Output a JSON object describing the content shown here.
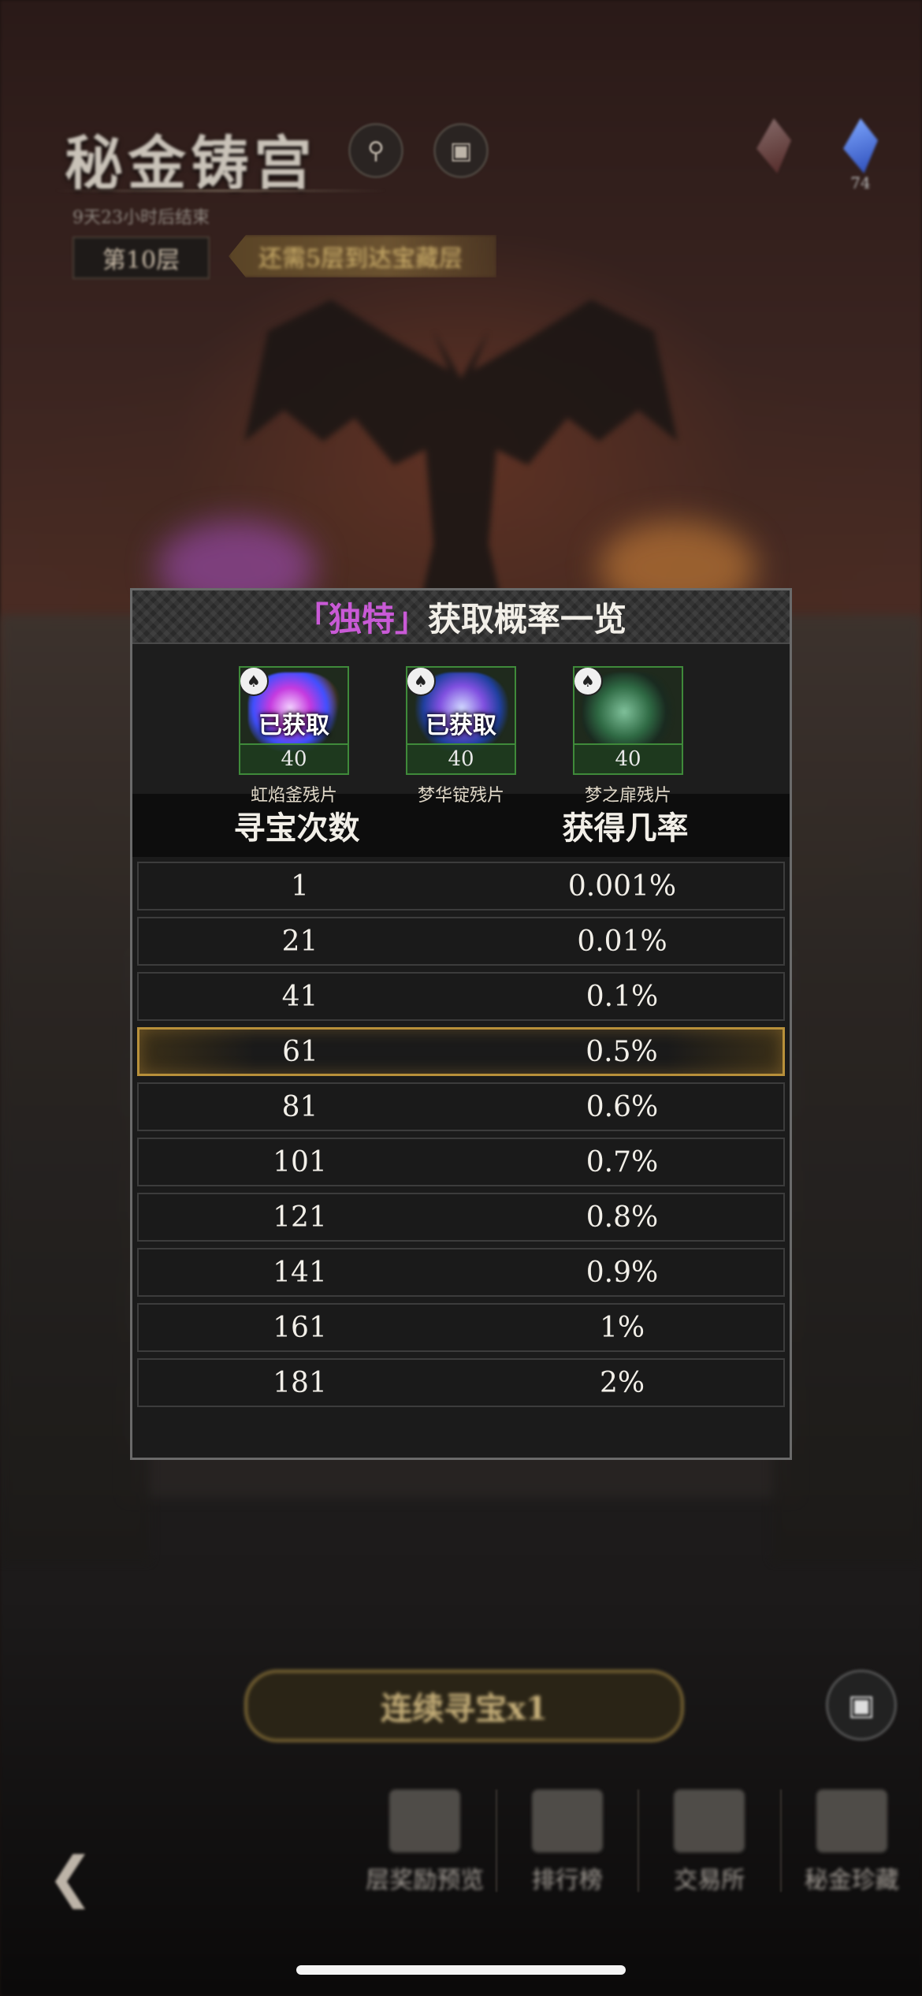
{
  "header": {
    "title": "秘金铸宫",
    "timer": "9天23小时后结束",
    "floor": "第10层",
    "floor_tip": "还需5层到达宝藏层",
    "currency_right_value": "74"
  },
  "modal": {
    "title_bracket_open": "「",
    "title_unique": "独特",
    "title_bracket_close": "」",
    "title_rest": "获取概率一览",
    "rewards": [
      {
        "name": "虹焰釜残片",
        "count": "40",
        "obtained_label": "已获取"
      },
      {
        "name": "梦华锭残片",
        "count": "40",
        "obtained_label": "已获取"
      },
      {
        "name": "梦之扉残片",
        "count": "40",
        "obtained_label": ""
      }
    ],
    "columns": [
      "寻宝次数",
      "获得几率"
    ],
    "rows": [
      {
        "count": "1",
        "rate": "0.001%"
      },
      {
        "count": "21",
        "rate": "0.01%"
      },
      {
        "count": "41",
        "rate": "0.1%"
      },
      {
        "count": "61",
        "rate": "0.5%"
      },
      {
        "count": "81",
        "rate": "0.6%"
      },
      {
        "count": "101",
        "rate": "0.7%"
      },
      {
        "count": "121",
        "rate": "0.8%"
      },
      {
        "count": "141",
        "rate": "0.9%"
      },
      {
        "count": "161",
        "rate": "1%"
      },
      {
        "count": "181",
        "rate": "2%"
      }
    ],
    "highlight_row": 3
  },
  "bottom": {
    "continue_label": "连续寻宝x1",
    "nav": [
      "层奖励预览",
      "排行榜",
      "交易所",
      "秘金珍藏"
    ]
  },
  "colors": {
    "unique_accent": "#c95ad6",
    "highlight_border": "#b8903a",
    "reward_border": "#3f8a3a"
  }
}
